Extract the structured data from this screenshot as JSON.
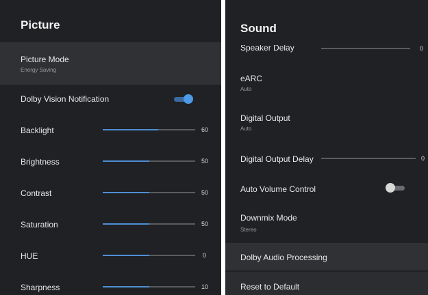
{
  "picture": {
    "title": "Picture",
    "picture_mode": {
      "label": "Picture Mode",
      "value": "Energy Saving"
    },
    "dolby_vision": {
      "label": "Dolby Vision Notification",
      "enabled": true
    },
    "sliders": [
      {
        "label": "Backlight",
        "value": "60",
        "level": 0.6
      },
      {
        "label": "Brightness",
        "value": "50",
        "level": 0.5
      },
      {
        "label": "Contrast",
        "value": "50",
        "level": 0.5
      },
      {
        "label": "Saturation",
        "value": "50",
        "level": 0.5
      },
      {
        "label": "HUE",
        "value": "0",
        "level": 0.5
      },
      {
        "label": "Sharpness",
        "value": "10",
        "level": 0.5
      }
    ]
  },
  "sound": {
    "title": "Sound",
    "speaker_delay": {
      "label": "Speaker Delay",
      "value": "0"
    },
    "earc": {
      "label": "eARC",
      "value": "Auto"
    },
    "digital_output": {
      "label": "Digital Output",
      "value": "Auto"
    },
    "digital_output_delay": {
      "label": "Digital Output Delay",
      "value": "0"
    },
    "auto_volume": {
      "label": "Auto Volume Control",
      "enabled": false
    },
    "downmix": {
      "label": "Downmix Mode",
      "value": "Stereo"
    },
    "dolby_audio": {
      "label": "Dolby Audio Processing"
    },
    "reset": {
      "label": "Reset to Default"
    }
  },
  "colors": {
    "panel_bg": "#1f2124",
    "highlight_bg": "#2f3134",
    "accent": "#4f8fd6"
  }
}
